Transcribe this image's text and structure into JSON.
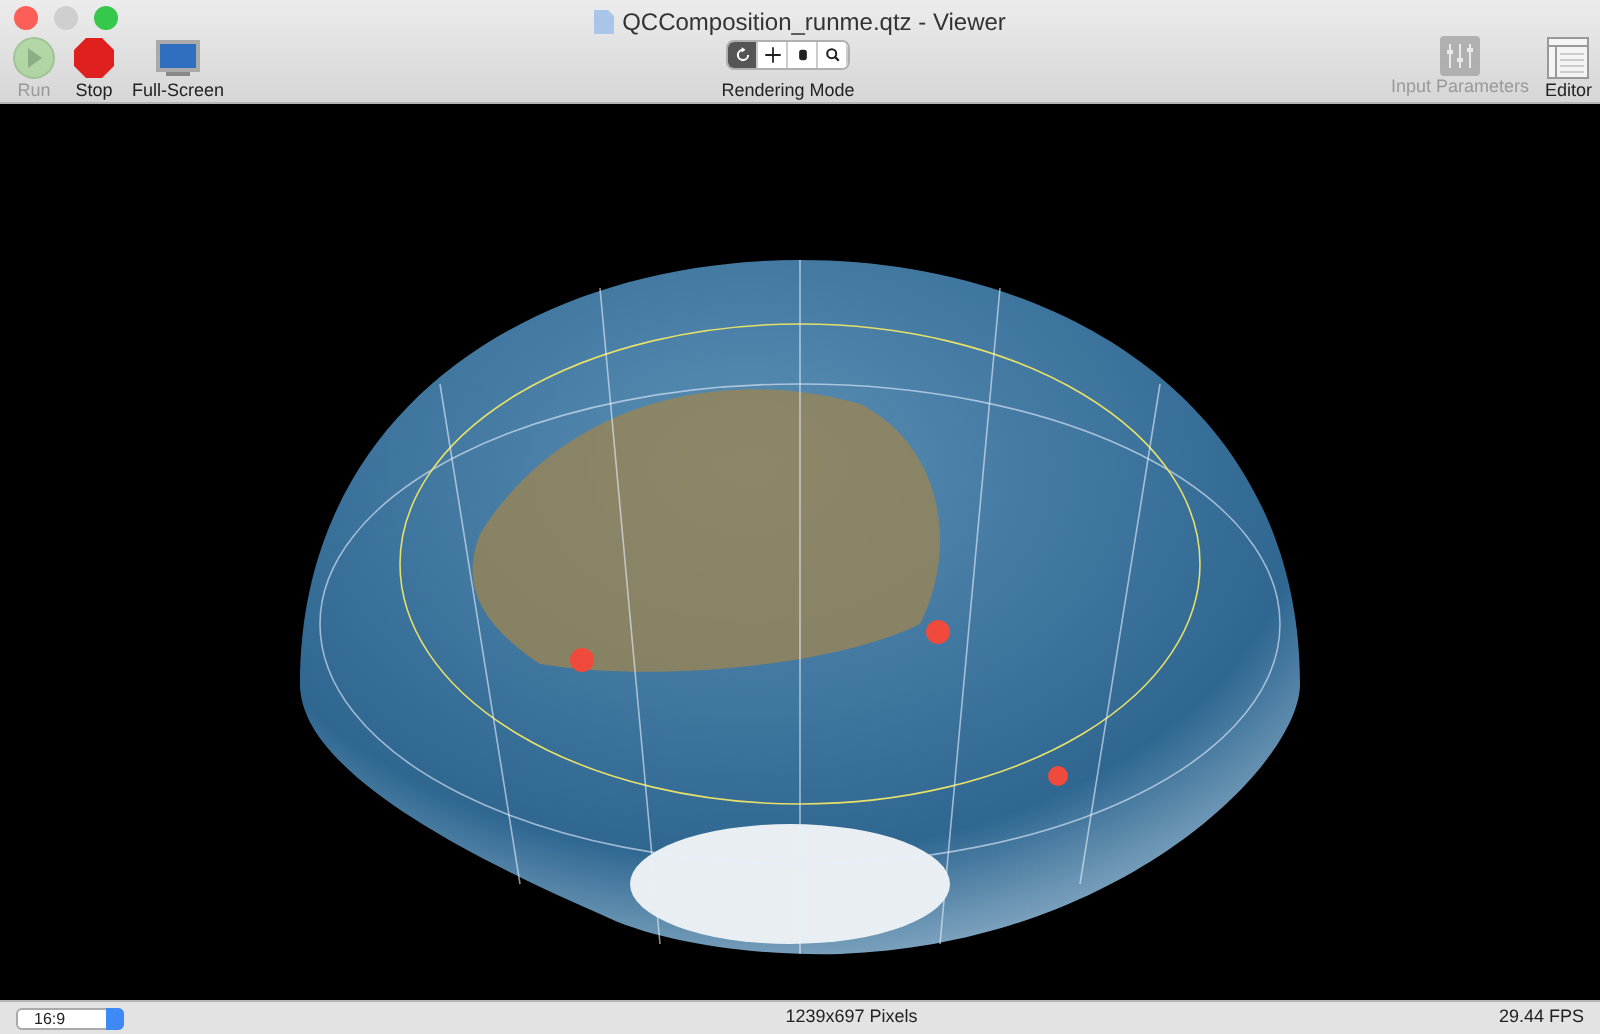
{
  "window": {
    "title": "QCComposition_runme.qtz - Viewer"
  },
  "toolbar_left": [
    {
      "kind": "run",
      "label": "Run",
      "disabled": true
    },
    {
      "kind": "stop",
      "label": "Stop",
      "disabled": false
    },
    {
      "kind": "fullscreen",
      "label": "Full-Screen",
      "disabled": false
    }
  ],
  "rendering_mode": {
    "label": "Rendering Mode",
    "segments": [
      {
        "kind": "rotate",
        "selected": true
      },
      {
        "kind": "move",
        "selected": false
      },
      {
        "kind": "hand",
        "selected": false
      },
      {
        "kind": "zoom",
        "selected": false
      }
    ]
  },
  "toolbar_right": [
    {
      "kind": "parameters",
      "label": "Input Parameters",
      "disabled": true
    },
    {
      "kind": "editor",
      "label": "Editor",
      "disabled": false
    }
  ],
  "status_bar": {
    "aspect": "16:9",
    "resolution": "1239x697 Pixels",
    "fps": "29.44 FPS"
  }
}
